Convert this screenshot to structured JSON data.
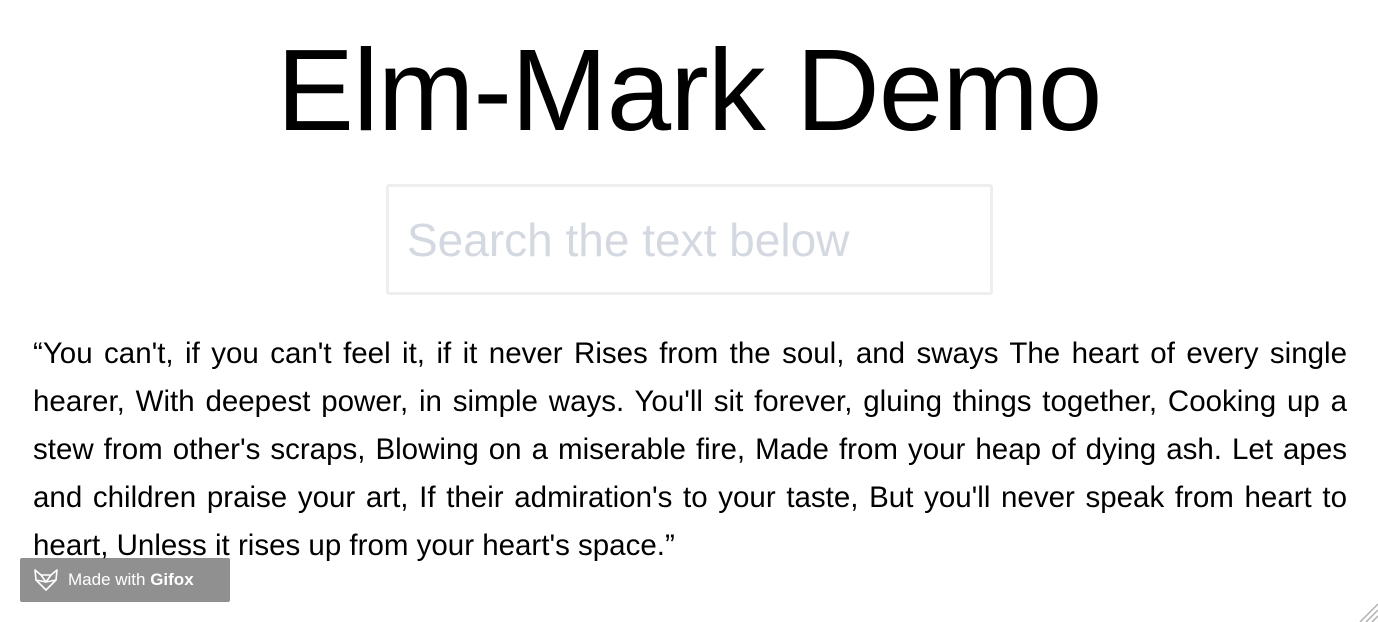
{
  "header": {
    "title": "Elm-Mark Demo"
  },
  "search": {
    "placeholder": "Search the text below",
    "value": ""
  },
  "content": {
    "text": "“You can't, if you can't feel it, if it never Rises from the soul, and sways The heart of every single hearer, With deepest power, in simple ways. You'll sit forever, gluing things together, Cooking up a stew from other's scraps, Blowing on a miserable fire, Made from your heap of dying ash. Let apes and children praise your art, If their admiration's to your taste, But you'll never speak from heart to heart, Unless it rises up from your heart's space.”"
  },
  "watermark": {
    "prefix": "Made with ",
    "brand": "Gifox",
    "icon": "fox-logo-icon"
  }
}
